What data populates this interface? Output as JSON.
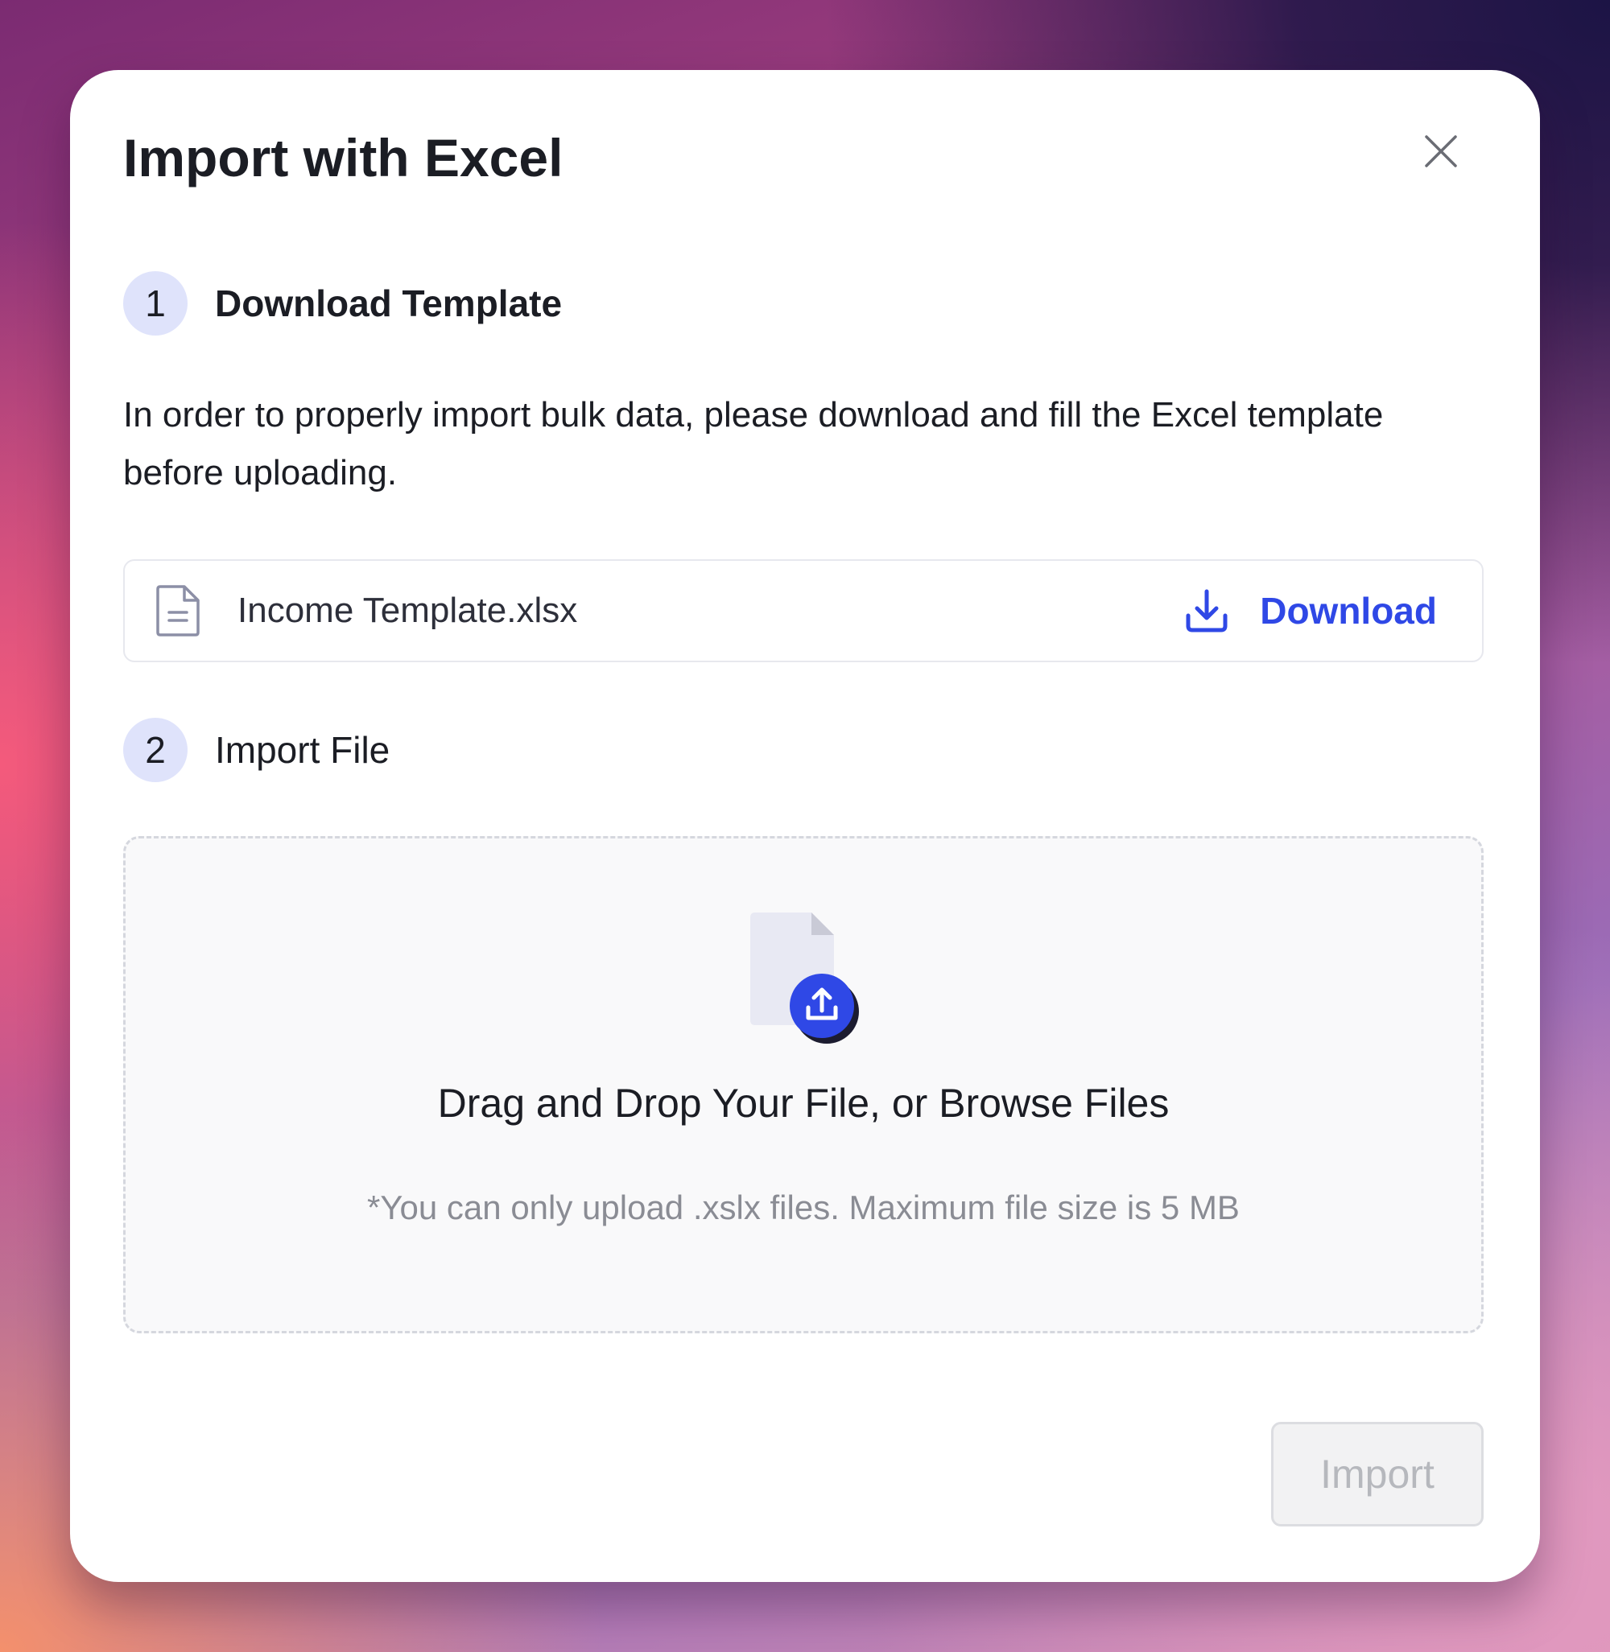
{
  "dialog": {
    "title": "Import with Excel",
    "close_icon": "close-icon"
  },
  "steps": [
    {
      "number": "1",
      "title": "Download Template"
    },
    {
      "number": "2",
      "title": "Import File"
    }
  ],
  "download_section": {
    "description": "In order to properly import bulk data, please download and fill the Excel template before uploading.",
    "file_icon": "file-document-icon",
    "file_name": "Income Template.xlsx",
    "download_icon": "download-icon",
    "download_label": "Download"
  },
  "upload_section": {
    "illustration_icon": "file-upload-icon",
    "title": "Drag and Drop Your File, or Browse Files",
    "note": "*You can only upload .xslx files. Maximum file size is 5 MB"
  },
  "footer": {
    "import_label": "Import",
    "import_disabled": true
  },
  "colors": {
    "accent": "#2f48e6",
    "step_badge_bg": "#dfe3fb",
    "text_primary": "#1b1d24",
    "text_muted": "#8a8c94",
    "disabled_text": "#b6b8bd"
  }
}
